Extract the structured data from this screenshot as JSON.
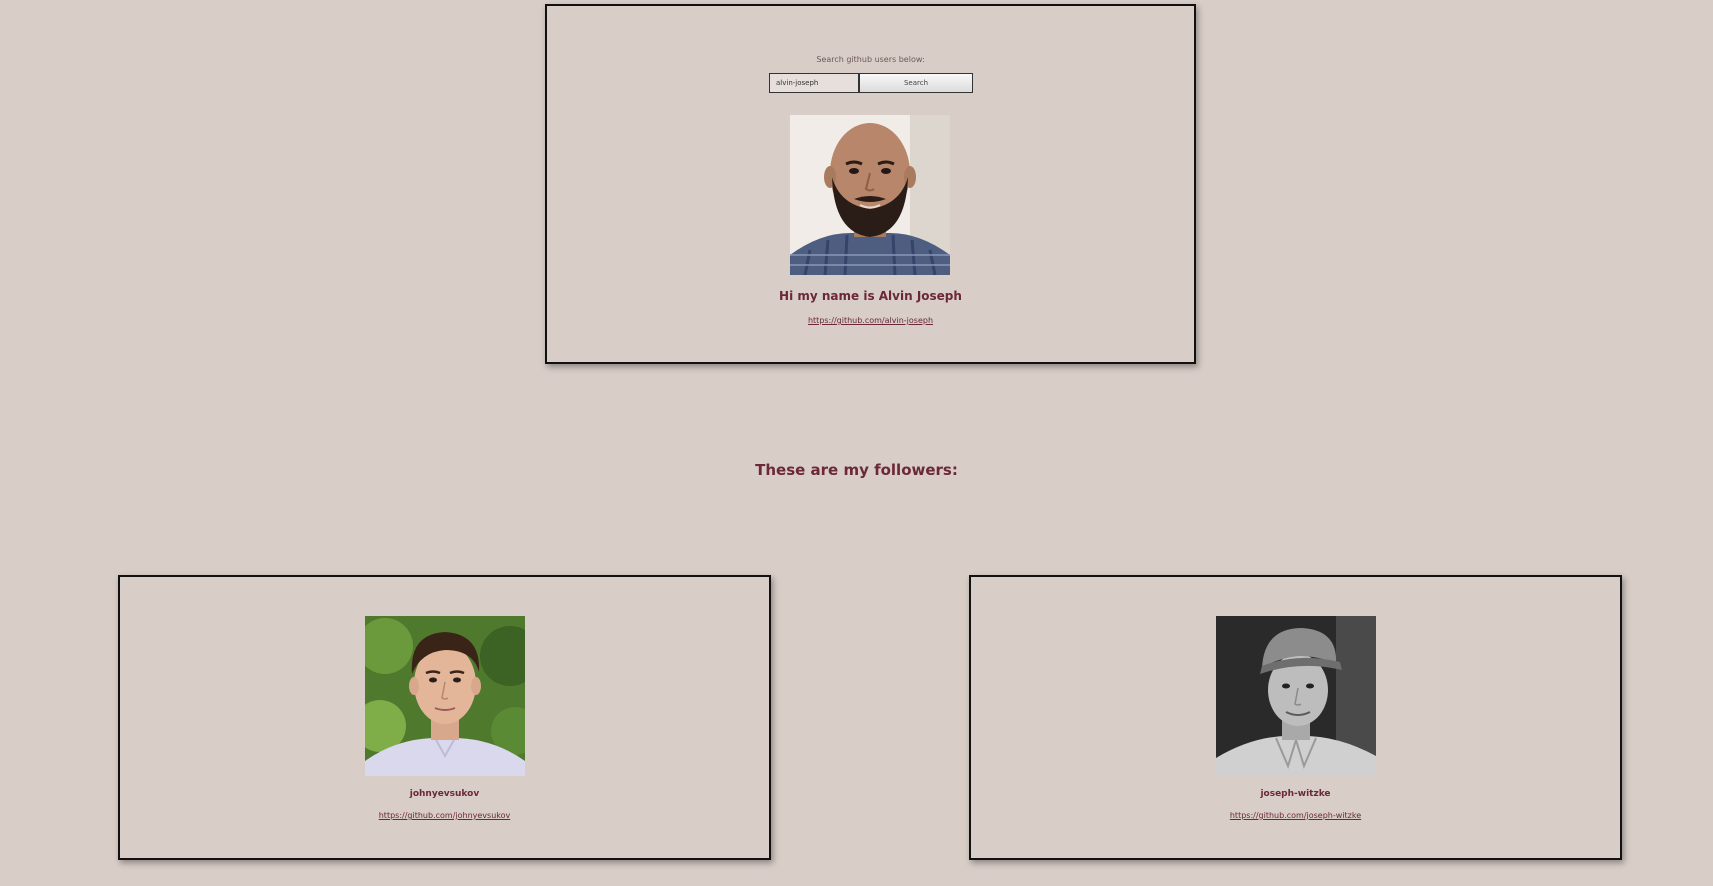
{
  "search": {
    "label": "Search github users below:",
    "value": "alvin-joseph",
    "button_label": "Search"
  },
  "profile": {
    "greeting": "Hi my name is Alvin Joseph",
    "url": "https://github.com/alvin-joseph",
    "avatar_icon": "person-photo-avatar"
  },
  "followers_heading": "These are my followers:",
  "followers": [
    {
      "login": "johnyevsukov",
      "url": "https://github.com/johnyevsukov",
      "avatar_icon": "person-photo-avatar"
    },
    {
      "login": "joseph-witzke",
      "url": "https://github.com/joseph-witzke",
      "avatar_icon": "person-photo-avatar"
    }
  ],
  "colors": {
    "background": "#d8cdc7",
    "accent_text": "#6b2838",
    "border": "#111111"
  }
}
